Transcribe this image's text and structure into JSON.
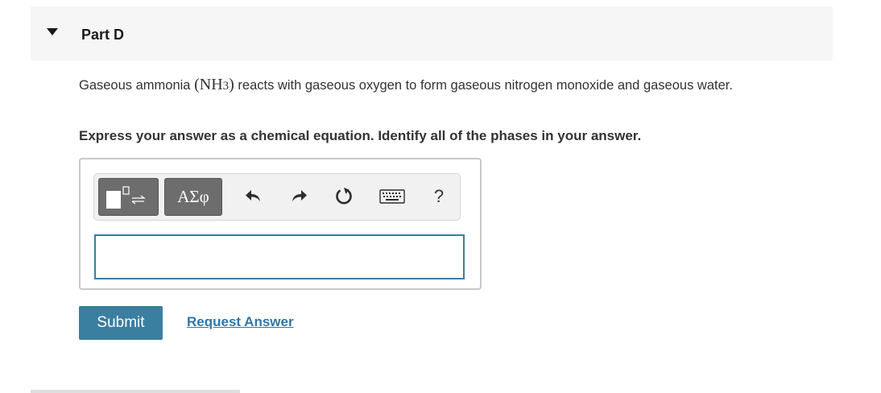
{
  "part": {
    "title": "Part D",
    "toggle_icon": "caret-down-icon"
  },
  "question": {
    "text_before": "Gaseous ammonia ",
    "formula_open": "(",
    "formula_main": "NH",
    "formula_sub": "3",
    "formula_close": ")",
    "text_after": " reacts with gaseous oxygen to form gaseous nitrogen monoxide and gaseous water."
  },
  "instruction": "Express your answer as a chemical equation. Identify all of the phases in your answer.",
  "toolbar": {
    "template_icon": "chem-template-icon",
    "greek_label": "ΑΣφ",
    "undo_icon": "undo-icon",
    "redo_icon": "redo-icon",
    "reset_icon": "reset-icon",
    "keyboard_icon": "keyboard-icon",
    "help_label": "?"
  },
  "answer": {
    "value": ""
  },
  "actions": {
    "submit_label": "Submit",
    "request_label": "Request Answer"
  },
  "colors": {
    "accent": "#3a7ea0",
    "link": "#2f77a8",
    "header_bg": "#f6f6f6",
    "toolbar_button": "#6d6d6d"
  }
}
